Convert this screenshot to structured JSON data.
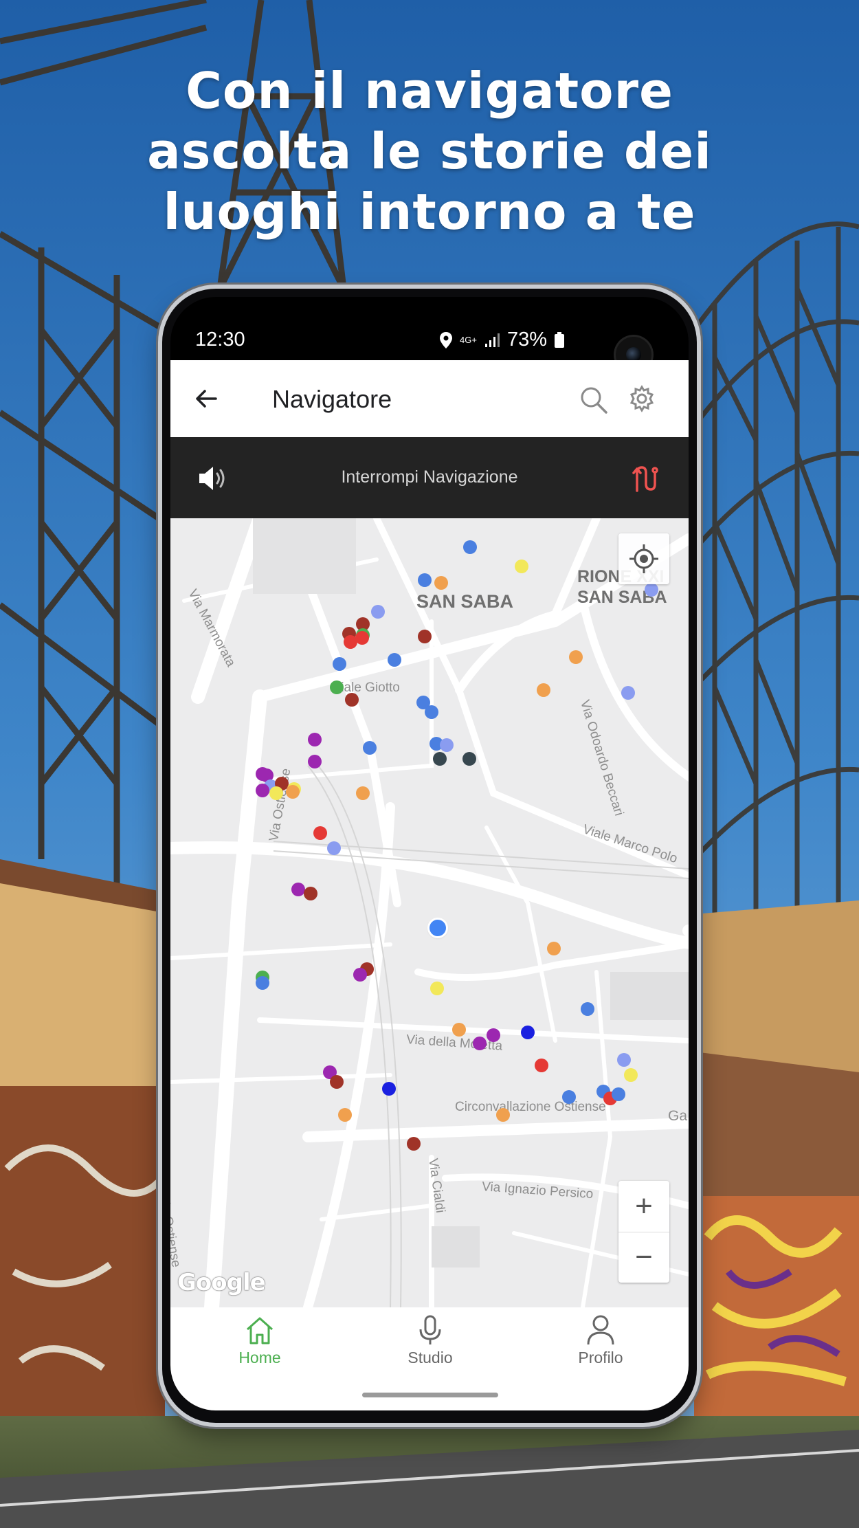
{
  "headline": {
    "line1": "Con il navigatore",
    "line2": "ascolta le storie dei",
    "line3": "luoghi intorno a te"
  },
  "status_bar": {
    "time": "12:30",
    "network_top": "4G+",
    "battery": "73%"
  },
  "app_bar": {
    "title": "Navigatore",
    "back_icon": "arrow-left-icon",
    "search_icon": "search-icon",
    "settings_icon": "gear-icon"
  },
  "navigation_bar": {
    "audio_icon": "speaker-icon",
    "stop_label": "Interrompi Navigazione",
    "route_icon": "route-icon",
    "route_color": "#ef5350"
  },
  "map": {
    "districts": [
      {
        "text": "SAN SABA"
      },
      {
        "text": "RIONE XXI"
      },
      {
        "text": "SAN SABA"
      }
    ],
    "streets": [
      "Via Marmorata",
      "Viale Giotto",
      "Via Ostiense",
      "Via Odoardo Beccari",
      "Viale Marco Polo",
      "Via della Moletta",
      "Circonvallazione Ostiense",
      "Via Cialdi",
      "Via Ignazio Persico",
      "Via Ostiense",
      "Ga"
    ],
    "attribution": "Google",
    "zoom_in": "+",
    "zoom_out": "−",
    "locate_icon": "my-location-icon"
  },
  "bottom_nav": {
    "tabs": [
      {
        "label": "Home",
        "icon": "home-icon",
        "active": true
      },
      {
        "label": "Studio",
        "icon": "microphone-icon",
        "active": false
      },
      {
        "label": "Profilo",
        "icon": "person-icon",
        "active": false
      }
    ],
    "active_color": "#4caf50"
  }
}
